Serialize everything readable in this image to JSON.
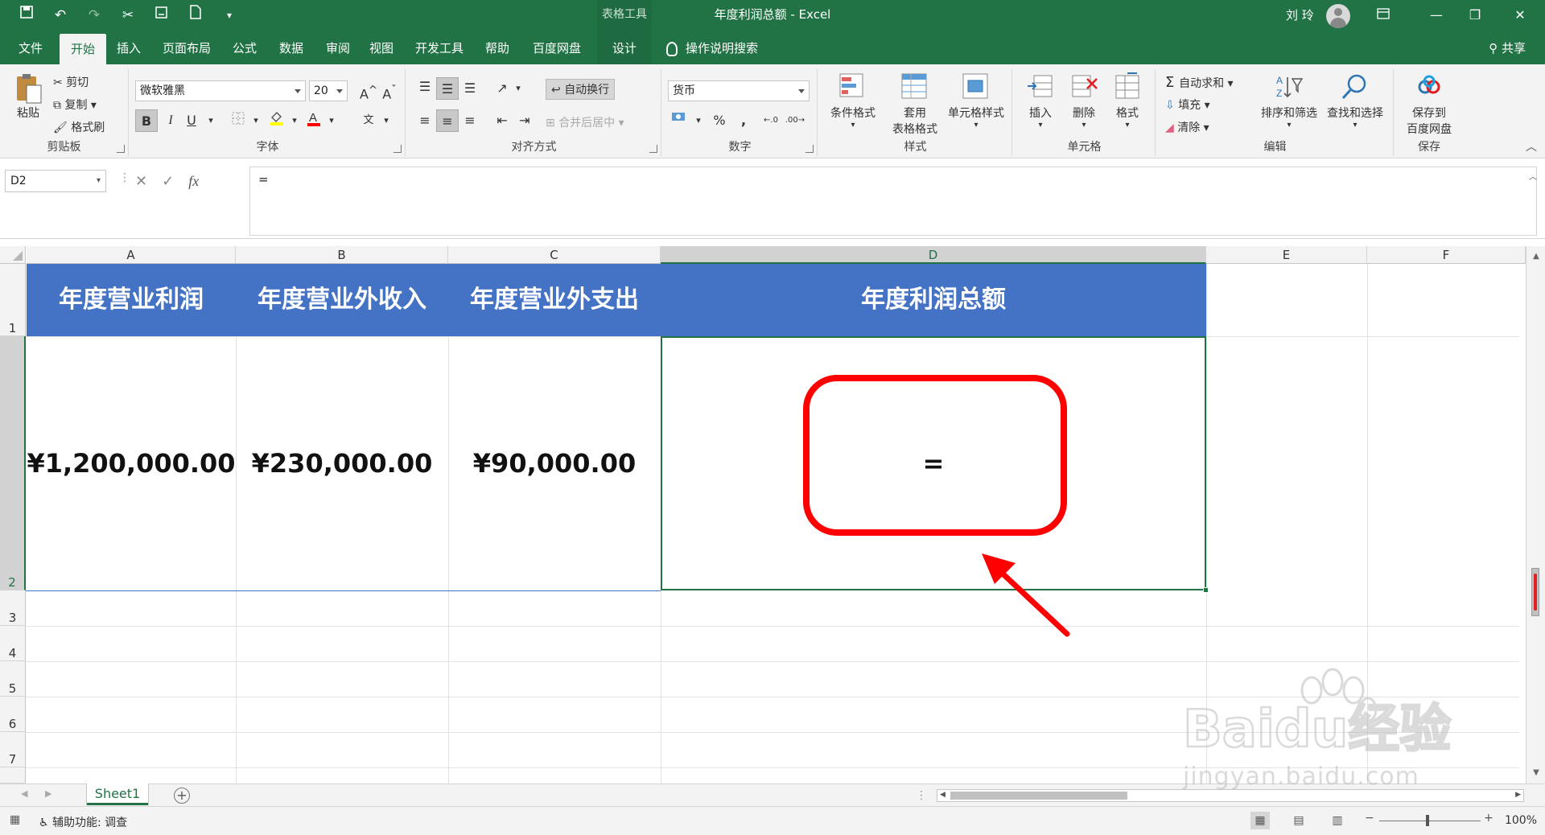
{
  "titlebar": {
    "context_tab": "表格工具",
    "doc_title": "年度利润总额  -  Excel",
    "user": "刘 玲"
  },
  "tabs": [
    "文件",
    "开始",
    "插入",
    "页面布局",
    "公式",
    "数据",
    "审阅",
    "视图",
    "开发工具",
    "帮助",
    "百度网盘",
    "设计"
  ],
  "tellme": "操作说明搜索",
  "share": "共享",
  "ribbon": {
    "clipboard": {
      "label": "剪贴板",
      "paste": "粘贴",
      "cut": "剪切",
      "copy": "复制",
      "format_painter": "格式刷"
    },
    "font": {
      "label": "字体",
      "font_name": "微软雅黑",
      "font_size": "20",
      "bold": "B",
      "italic": "I",
      "underline": "U"
    },
    "align": {
      "label": "对齐方式",
      "wrap": "自动换行",
      "merge": "合并后居中"
    },
    "number": {
      "label": "数字",
      "format": "货币"
    },
    "styles": {
      "label": "样式",
      "cond": "条件格式",
      "table_line1": "套用",
      "table_line2": "表格格式",
      "cell_styles": "单元格样式"
    },
    "cells": {
      "label": "单元格",
      "insert": "插入",
      "delete": "删除",
      "format": "格式"
    },
    "editing": {
      "label": "编辑",
      "autosum": "自动求和",
      "fill": "填充",
      "clear": "清除",
      "sort": "排序和筛选",
      "find": "查找和选择"
    },
    "save": {
      "label": "保存",
      "line1": "保存到",
      "line2": "百度网盘"
    }
  },
  "formula_bar": {
    "name_box": "D2",
    "formula": "="
  },
  "columns": [
    "A",
    "B",
    "C",
    "D",
    "E",
    "F"
  ],
  "rows": [
    "1",
    "2",
    "3",
    "4",
    "5",
    "6",
    "7"
  ],
  "headers": [
    "年度营业利润",
    "年度营业外收入",
    "年度营业外支出",
    "年度利润总额"
  ],
  "values": [
    "¥1,200,000.00",
    "¥230,000.00",
    "¥90,000.00",
    "="
  ],
  "sheet": {
    "name": "Sheet1"
  },
  "status": {
    "accessibility": "辅助功能: 调查",
    "zoom": "100%"
  },
  "watermark": {
    "brand": "Baidu经验",
    "url": "jingyan.baidu.com"
  },
  "colors": {
    "excel_green": "#217346",
    "header_blue": "#4472c4",
    "callout_red": "#ff0000"
  }
}
